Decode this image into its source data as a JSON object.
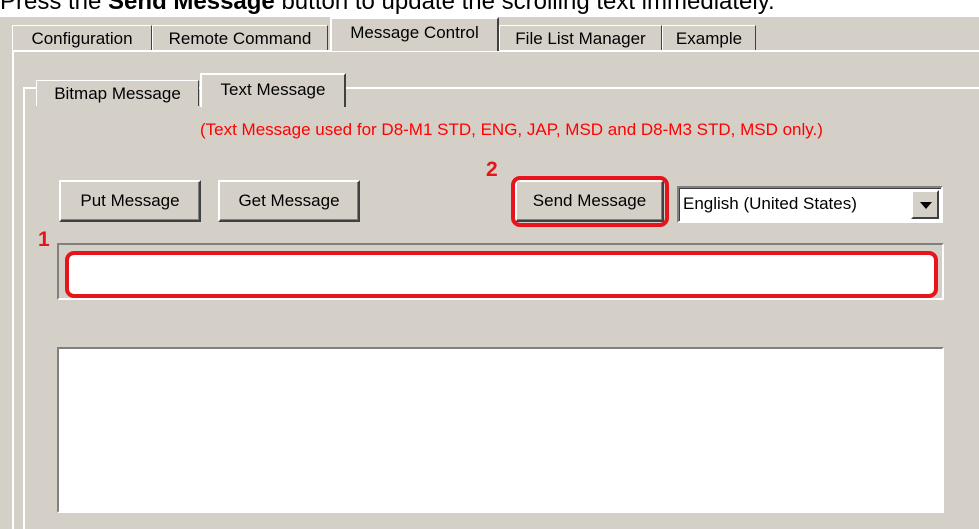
{
  "caption": {
    "prefix": "Press the ",
    "bold": "Send Message",
    "suffix": " button to update the scrolling text immediately."
  },
  "outer_tabs": [
    {
      "label": "Configuration"
    },
    {
      "label": "Remote Command"
    },
    {
      "label": "Message Control"
    },
    {
      "label": "File List Manager"
    },
    {
      "label": "Example"
    }
  ],
  "inner_tabs": [
    {
      "label": "Bitmap Message"
    },
    {
      "label": "Text Message"
    }
  ],
  "notice": "(Text Message used for D8-M1 STD, ENG, JAP, MSD and D8-M3 STD, MSD only.)",
  "buttons": {
    "put_message": "Put Message",
    "get_message": "Get Message",
    "send_message": "Send Message"
  },
  "language_select": {
    "value": "English (United States)"
  },
  "message_input": {
    "value": ""
  },
  "message_preview": {
    "value": ""
  },
  "markers": {
    "m1": "1",
    "m2": "2"
  },
  "colors": {
    "highlight": "#e8141b",
    "notice": "#ff0000",
    "window_bg": "#d4d0c8"
  }
}
